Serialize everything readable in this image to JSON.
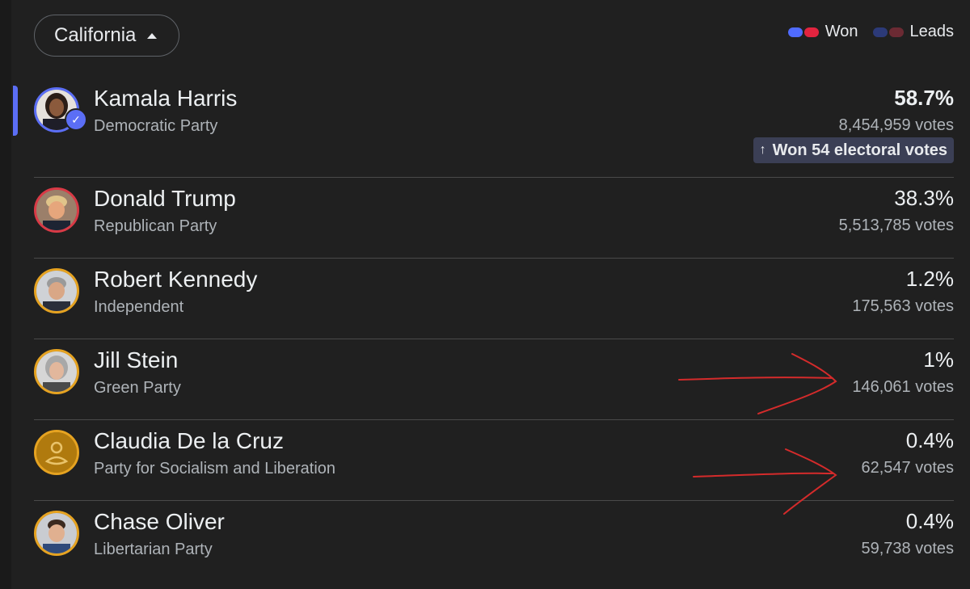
{
  "header": {
    "state": "California"
  },
  "legend": {
    "won_label": "Won",
    "leads_label": "Leads",
    "won_colors": [
      "#4f6bff",
      "#e2243f"
    ],
    "leads_colors": [
      "#2c3a78",
      "#6b2a33"
    ]
  },
  "candidates": [
    {
      "name": "Kamala Harris",
      "party": "Democratic Party",
      "percent": "58.7%",
      "votes": "8,454,959 votes",
      "badge": "Won 54 electoral votes",
      "ring_color": "#5b6ef5",
      "winner": true
    },
    {
      "name": "Donald Trump",
      "party": "Republican Party",
      "percent": "38.3%",
      "votes": "5,513,785 votes",
      "ring_color": "#d93a46"
    },
    {
      "name": "Robert Kennedy",
      "party": "Independent",
      "percent": "1.2%",
      "votes": "175,563 votes",
      "ring_color": "#e6a321"
    },
    {
      "name": "Jill Stein",
      "party": "Green Party",
      "percent": "1%",
      "votes": "146,061 votes",
      "ring_color": "#e6a321"
    },
    {
      "name": "Claudia De la Cruz",
      "party": "Party for Socialism and Liberation",
      "percent": "0.4%",
      "votes": "62,547 votes",
      "ring_color": "#e6a321"
    },
    {
      "name": "Chase Oliver",
      "party": "Libertarian Party",
      "percent": "0.4%",
      "votes": "59,738 votes",
      "ring_color": "#e6a321"
    }
  ],
  "annotations": {
    "arrow_color": "#d42b2b"
  }
}
